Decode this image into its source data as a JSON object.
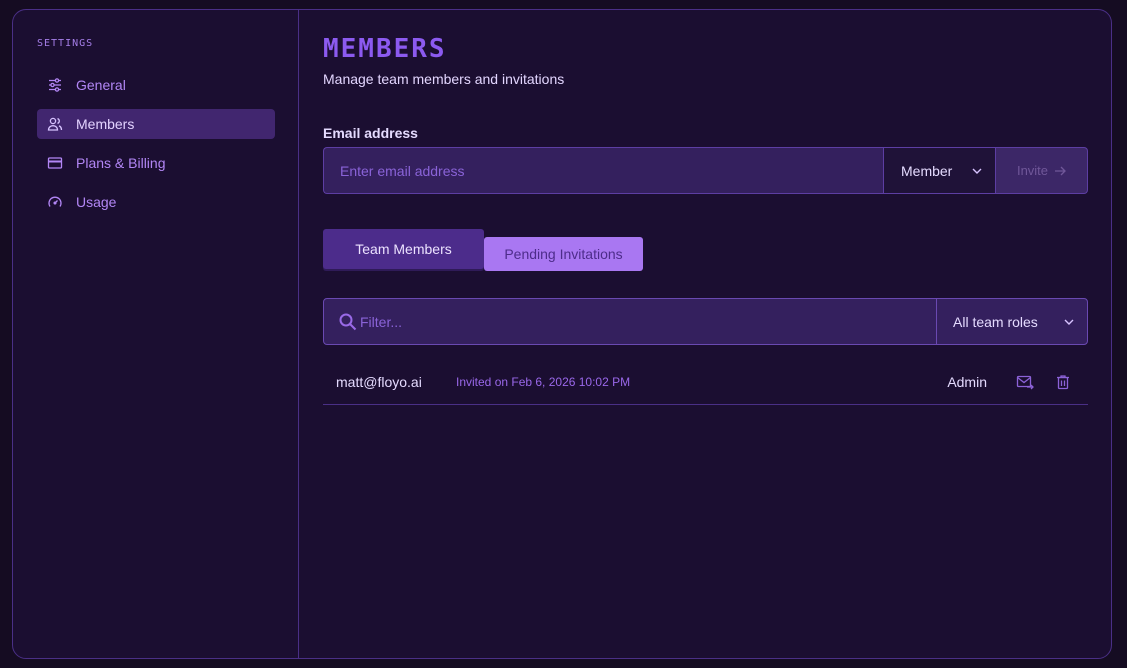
{
  "sidebar": {
    "heading": "SETTINGS",
    "items": [
      {
        "label": "General",
        "icon": "sliders-icon"
      },
      {
        "label": "Members",
        "icon": "users-icon",
        "active": true
      },
      {
        "label": "Plans & Billing",
        "icon": "credit-card-icon"
      },
      {
        "label": "Usage",
        "icon": "gauge-icon"
      }
    ]
  },
  "main": {
    "title": "MEMBERS",
    "subtitle": "Manage team members and invitations",
    "invite": {
      "label": "Email address",
      "placeholder": "Enter email address",
      "role": "Member",
      "button_label": "Invite",
      "button_icon": "arrow-right-icon"
    },
    "tabs": [
      {
        "label": "Team Members"
      },
      {
        "label": "Pending Invitations"
      }
    ],
    "filter": {
      "placeholder": "Filter...",
      "role_filter": "All team roles"
    },
    "rows": [
      {
        "email": "matt@floyo.ai",
        "invited": "Invited on Feb 6, 2026 10:02 PM",
        "role": "Admin",
        "actions": [
          "resend-mail-icon",
          "trash-icon"
        ]
      }
    ]
  },
  "colors": {
    "background": "#150c22",
    "panel": "#1b0e31",
    "accent": "#8c5af0",
    "active_nav": "#41266f",
    "border": "#4a2f86"
  }
}
